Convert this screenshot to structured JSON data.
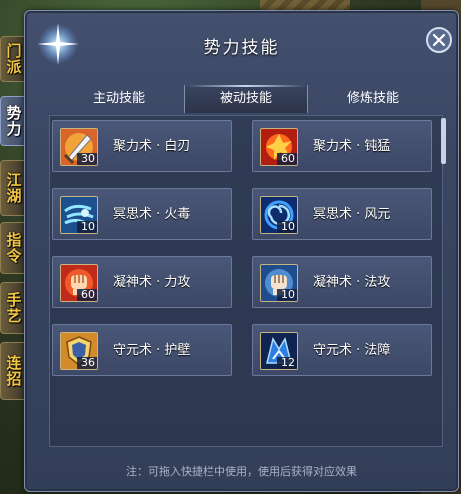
{
  "window": {
    "title": "势力技能",
    "close_icon": "close-icon"
  },
  "side_tabs": [
    {
      "label": "门派",
      "active": false
    },
    {
      "label": "势力",
      "active": true
    },
    {
      "label": "江湖",
      "active": false
    },
    {
      "label": "指令",
      "active": false
    },
    {
      "label": "手艺",
      "active": false
    },
    {
      "label": "连招",
      "active": false
    }
  ],
  "tabs": [
    {
      "label": "主动技能",
      "active": false
    },
    {
      "label": "被动技能",
      "active": true
    },
    {
      "label": "修炼技能",
      "active": false
    }
  ],
  "skills": [
    {
      "name": "聚力术 · 白刃",
      "level": "30",
      "icon": "sword-icon"
    },
    {
      "name": "聚力术 · 钝猛",
      "level": "60",
      "icon": "fire-burst-icon"
    },
    {
      "name": "冥思术 · 火毒",
      "level": "10",
      "icon": "frost-wind-icon"
    },
    {
      "name": "冥思术 · 风元",
      "level": "10",
      "icon": "vortex-icon"
    },
    {
      "name": "凝神术 · 力攻",
      "level": "60",
      "icon": "red-fist-icon"
    },
    {
      "name": "凝神术 · 法攻",
      "level": "10",
      "icon": "blue-fist-icon"
    },
    {
      "name": "守元术 · 护壁",
      "level": "36",
      "icon": "gold-shield-icon"
    },
    {
      "name": "守元术 · 法障",
      "level": "12",
      "icon": "blue-shield-icon"
    }
  ],
  "footer": {
    "note": "注：可拖入快捷栏中使用，使用后获得对应效果"
  },
  "colors": {
    "accent": "#f3c744",
    "panel": "#3a4662",
    "text": "#ffffff"
  }
}
